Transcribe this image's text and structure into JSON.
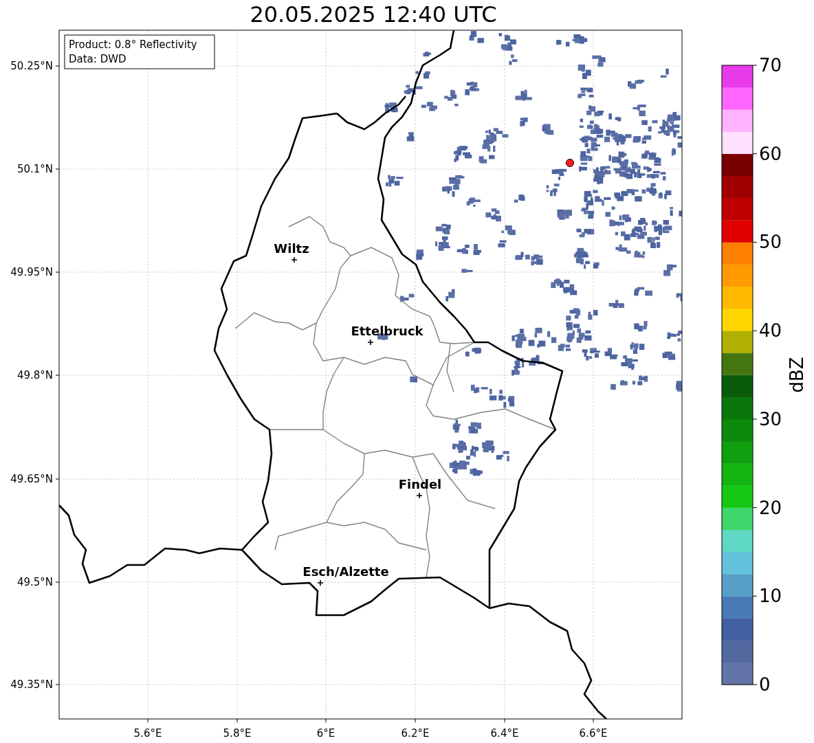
{
  "title": "20.05.2025 12:40 UTC",
  "legend": [
    "Product: 0.8° Reflectivity",
    "Data: DWD"
  ],
  "map": {
    "x_ticks": [
      "5.6°E",
      "5.8°E",
      "6°E",
      "6.2°E",
      "6.4°E",
      "6.6°E"
    ],
    "y_ticks": [
      "50.25°N",
      "50.1°N",
      "49.95°N",
      "49.8°N",
      "49.65°N",
      "49.5°N",
      "49.35°N"
    ],
    "cities": [
      {
        "name": "Wiltz"
      },
      {
        "name": "Ettelbruck"
      },
      {
        "name": "Findel"
      },
      {
        "name": "Esch/Alzette"
      }
    ]
  },
  "colorbar": {
    "label": "dBZ",
    "ticks": [
      "70",
      "60",
      "50",
      "40",
      "30",
      "20",
      "10",
      "0"
    ],
    "segments": [
      {
        "color": "#6374a8"
      },
      {
        "color": "#536aa0"
      },
      {
        "color": "#4460a0"
      },
      {
        "color": "#4a7ab4"
      },
      {
        "color": "#58a0c8"
      },
      {
        "color": "#64c3dc"
      },
      {
        "color": "#5fd8c4"
      },
      {
        "color": "#3dd66b"
      },
      {
        "color": "#14c814"
      },
      {
        "color": "#12b412"
      },
      {
        "color": "#0f9f0f"
      },
      {
        "color": "#0c8a0c"
      },
      {
        "color": "#0a760a"
      },
      {
        "color": "#0a5c0a"
      },
      {
        "color": "#447710"
      },
      {
        "color": "#b0b000"
      },
      {
        "color": "#ffd700"
      },
      {
        "color": "#ffb800"
      },
      {
        "color": "#ff9a00"
      },
      {
        "color": "#ff7f00"
      },
      {
        "color": "#e00000"
      },
      {
        "color": "#c00000"
      },
      {
        "color": "#a00000"
      },
      {
        "color": "#7a0000"
      },
      {
        "color": "#ffe0ff"
      },
      {
        "color": "#ffb3ff"
      },
      {
        "color": "#ff66ff"
      },
      {
        "color": "#e83ae8"
      }
    ]
  }
}
